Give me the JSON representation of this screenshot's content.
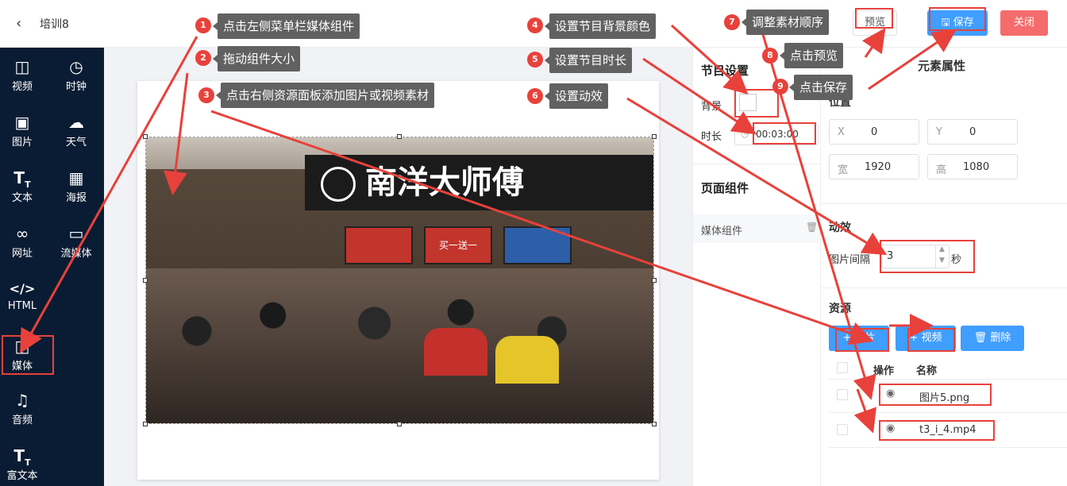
{
  "header": {
    "back_icon": "chevron-left-icon",
    "title": "培训8",
    "preview": "预览",
    "save": "保存",
    "close": "关闭"
  },
  "sidebar": {
    "items": [
      {
        "label": "视频",
        "icon": "video-icon"
      },
      {
        "label": "时钟",
        "icon": "clock-icon"
      },
      {
        "label": "图片",
        "icon": "image-icon"
      },
      {
        "label": "天气",
        "icon": "cloud-icon"
      },
      {
        "label": "文本",
        "icon": "text-icon"
      },
      {
        "label": "海报",
        "icon": "poster-icon"
      },
      {
        "label": "网址",
        "icon": "link-icon"
      },
      {
        "label": "流媒体",
        "icon": "stream-icon"
      },
      {
        "label": "HTML",
        "icon": "code-icon"
      },
      {
        "label": "媒体",
        "icon": "media-icon"
      },
      {
        "label": "音频",
        "icon": "music-icon"
      },
      {
        "label": "富文本",
        "icon": "rich-text-icon"
      }
    ]
  },
  "photo": {
    "sign_text": "南洋大师傅",
    "screen_text": "买一送一"
  },
  "program": {
    "title": "节目设置",
    "bg_label": "背景",
    "bg_color": "#ffffff",
    "duration_label": "时长",
    "duration_value": "00:03:00",
    "components_title": "页面组件",
    "component_item": "媒体组件"
  },
  "props": {
    "title": "元素属性",
    "position_title": "位置",
    "x_label": "X",
    "x_value": "0",
    "y_label": "Y",
    "y_value": "0",
    "w_label": "宽",
    "w_value": "1920",
    "h_label": "高",
    "h_value": "1080",
    "animation_title": "动效",
    "interval_label": "图片间隔",
    "interval_value": "3",
    "interval_unit": "秒",
    "resources_title": "资源",
    "add_image": "图片",
    "add_video": "视频",
    "delete": "删除",
    "col_action": "操作",
    "col_name": "名称",
    "rows": [
      {
        "name": "图片5.png"
      },
      {
        "name": "t3_i_4.mp4"
      }
    ]
  },
  "annotations": [
    {
      "num": "1",
      "text": "点击左侧菜单栏媒体组件"
    },
    {
      "num": "2",
      "text": "拖动组件大小"
    },
    {
      "num": "3",
      "text": "点击右侧资源面板添加图片或视频素材"
    },
    {
      "num": "4",
      "text": "设置节目背景颜色"
    },
    {
      "num": "5",
      "text": "设置节目时长"
    },
    {
      "num": "6",
      "text": "设置动效"
    },
    {
      "num": "7",
      "text": "调整素材顺序"
    },
    {
      "num": "8",
      "text": "点击预览"
    },
    {
      "num": "9",
      "text": "点击保存"
    }
  ],
  "colors": {
    "sidebar_bg": "#0a1c33",
    "primary": "#409eff",
    "danger": "#f56c6c",
    "annotation": "#e8413b",
    "tooltip_bg": "#616161"
  }
}
